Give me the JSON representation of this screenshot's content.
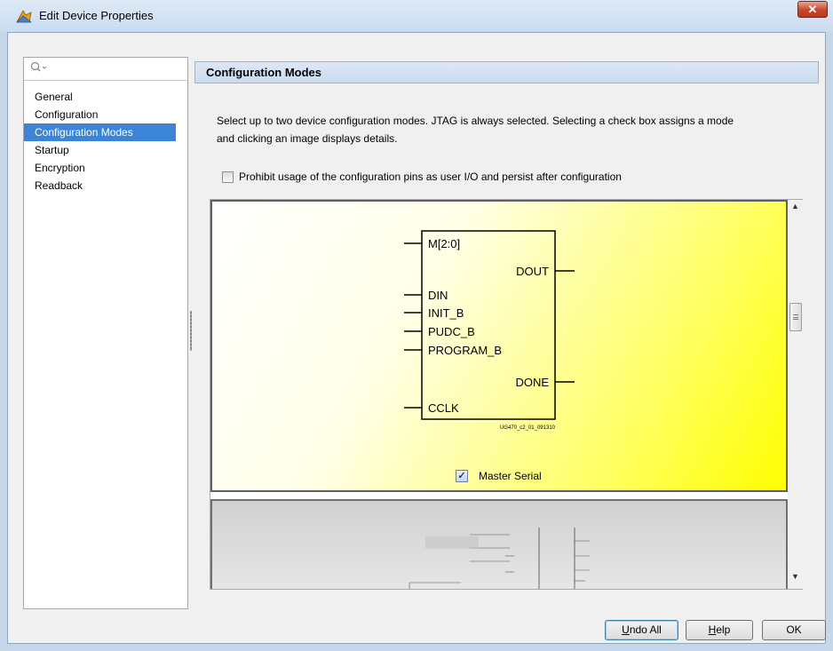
{
  "window": {
    "title": "Edit Device Properties",
    "close_glyph": "✕"
  },
  "nav": {
    "search_icon": "search-icon",
    "items": [
      {
        "label": "General"
      },
      {
        "label": "Configuration"
      },
      {
        "label": "Configuration Modes",
        "selected": true
      },
      {
        "label": "Startup"
      },
      {
        "label": "Encryption"
      },
      {
        "label": "Readback"
      }
    ]
  },
  "section": {
    "title": "Configuration Modes",
    "description_line1": "Select up to two device configuration modes. JTAG is always selected. Selecting a check box assigns a mode",
    "description_line2": "and clicking an image displays details.",
    "prohibit_label": "Prohibit usage of the configuration pins as user I/O and persist after configuration",
    "prohibit_checked": false
  },
  "modes": [
    {
      "name": "Master Serial",
      "checked": true,
      "pins_left": [
        "M[2:0]",
        "DIN",
        "INIT_B",
        "PUDC_B",
        "PROGRAM_B",
        "CCLK"
      ],
      "pins_right": [
        "DOUT",
        "DONE"
      ],
      "figure_id": "UG470_c2_01_091310"
    }
  ],
  "buttons": {
    "undo_prefix": "U",
    "undo_rest": "ndo All",
    "help_prefix": "H",
    "help_rest": "elp",
    "ok": "OK"
  },
  "colors": {
    "selected_bg": "#3c84d6",
    "mode_card_yellow": "#ffff00",
    "close_red": "#c7462b"
  }
}
